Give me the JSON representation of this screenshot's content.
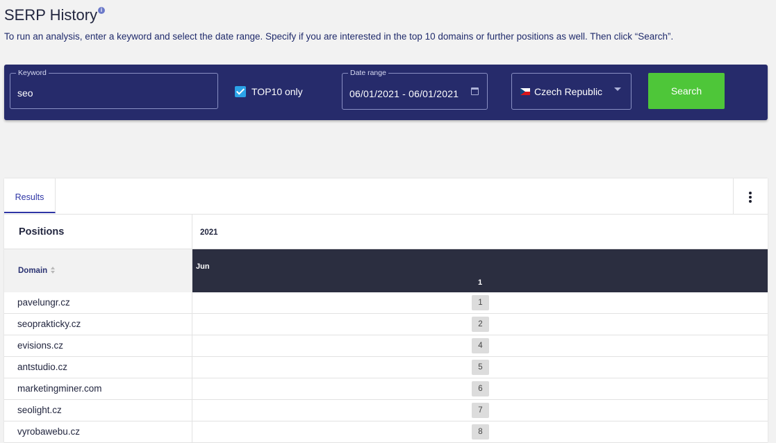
{
  "page": {
    "title": "SERP History",
    "description": "To run an analysis, enter a keyword and select the date range. Specify if you are interested in the top 10 domains or further positions as well. Then click “Search”."
  },
  "search": {
    "keyword_label": "Keyword",
    "keyword_value": "seo",
    "top10_label": "TOP10 only",
    "top10_checked": true,
    "date_range_label": "Date range",
    "date_range_value": "06/01/2021 - 06/01/2021",
    "country_value": "Czech Republic",
    "search_button": "Search"
  },
  "results": {
    "tab_label": "Results",
    "positions_label": "Positions",
    "year": "2021",
    "domain_header": "Domain",
    "month": "Jun",
    "day": "1",
    "rows": [
      {
        "domain": "pavelungr.cz",
        "position": "1"
      },
      {
        "domain": "seoprakticky.cz",
        "position": "2"
      },
      {
        "domain": "evisions.cz",
        "position": "4"
      },
      {
        "domain": "antstudio.cz",
        "position": "5"
      },
      {
        "domain": "marketingminer.com",
        "position": "6"
      },
      {
        "domain": "seolight.cz",
        "position": "7"
      },
      {
        "domain": "vyrobawebu.cz",
        "position": "8"
      }
    ]
  },
  "colors": {
    "search_bar": "#262b6b",
    "search_button": "#4ec639",
    "checkbox": "#2ba3e8",
    "date_header": "#2b2e40",
    "accent": "#2e35a5"
  },
  "icons": [
    "info-icon",
    "calendar-icon",
    "czech-flag-icon",
    "chevron-down-icon",
    "sort-icon",
    "more-vertical-icon"
  ]
}
